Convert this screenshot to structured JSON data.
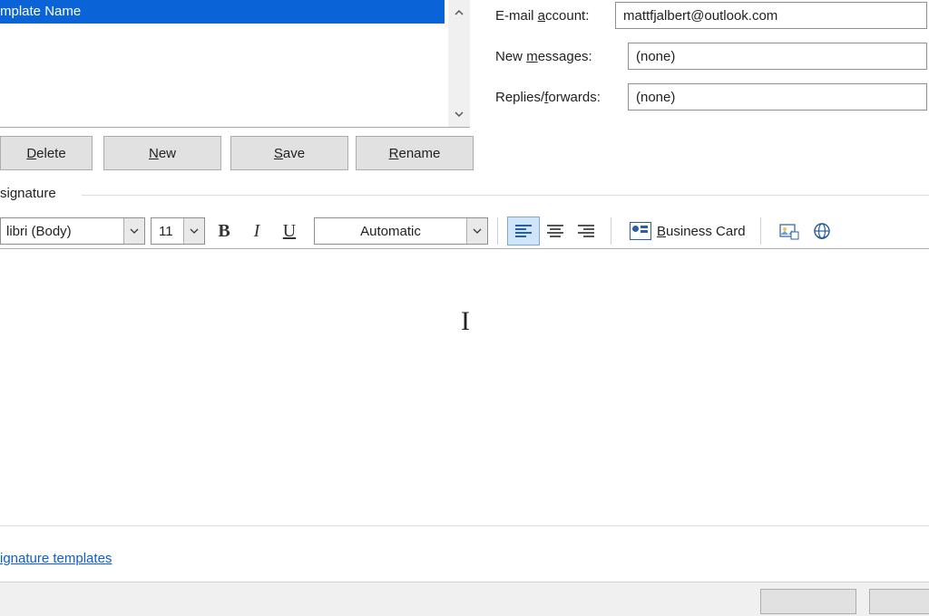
{
  "list": {
    "selected_item": "mplate Name"
  },
  "buttons": {
    "delete_pre": "",
    "delete_u": "D",
    "delete_post": "elete",
    "new_pre": "",
    "new_u": "N",
    "new_post": "ew",
    "save_pre": "",
    "save_u": "S",
    "save_post": "ave",
    "rename_pre": "",
    "rename_u": "R",
    "rename_post": "ename"
  },
  "fields": {
    "email_label_pre": "E-mail ",
    "email_label_u": "a",
    "email_label_post": "ccount:",
    "email_value": "mattfjalbert@outlook.com",
    "newmsg_label_pre": "New ",
    "newmsg_label_u": "m",
    "newmsg_label_post": "essages:",
    "newmsg_value": "(none)",
    "replies_label_pre": "Replies/",
    "replies_label_u": "f",
    "replies_label_post": "orwards:",
    "replies_value": "(none)"
  },
  "section": {
    "edit_label": "signature"
  },
  "toolbar": {
    "font_name": "libri (Body)",
    "font_size": "11",
    "color_label": "Automatic",
    "bizcard_pre": "",
    "bizcard_u": "B",
    "bizcard_post": "usiness Card"
  },
  "link": {
    "templates": "ignature templates"
  },
  "footer": {
    "ok_fragment": "",
    "cancel_fragment": ""
  }
}
